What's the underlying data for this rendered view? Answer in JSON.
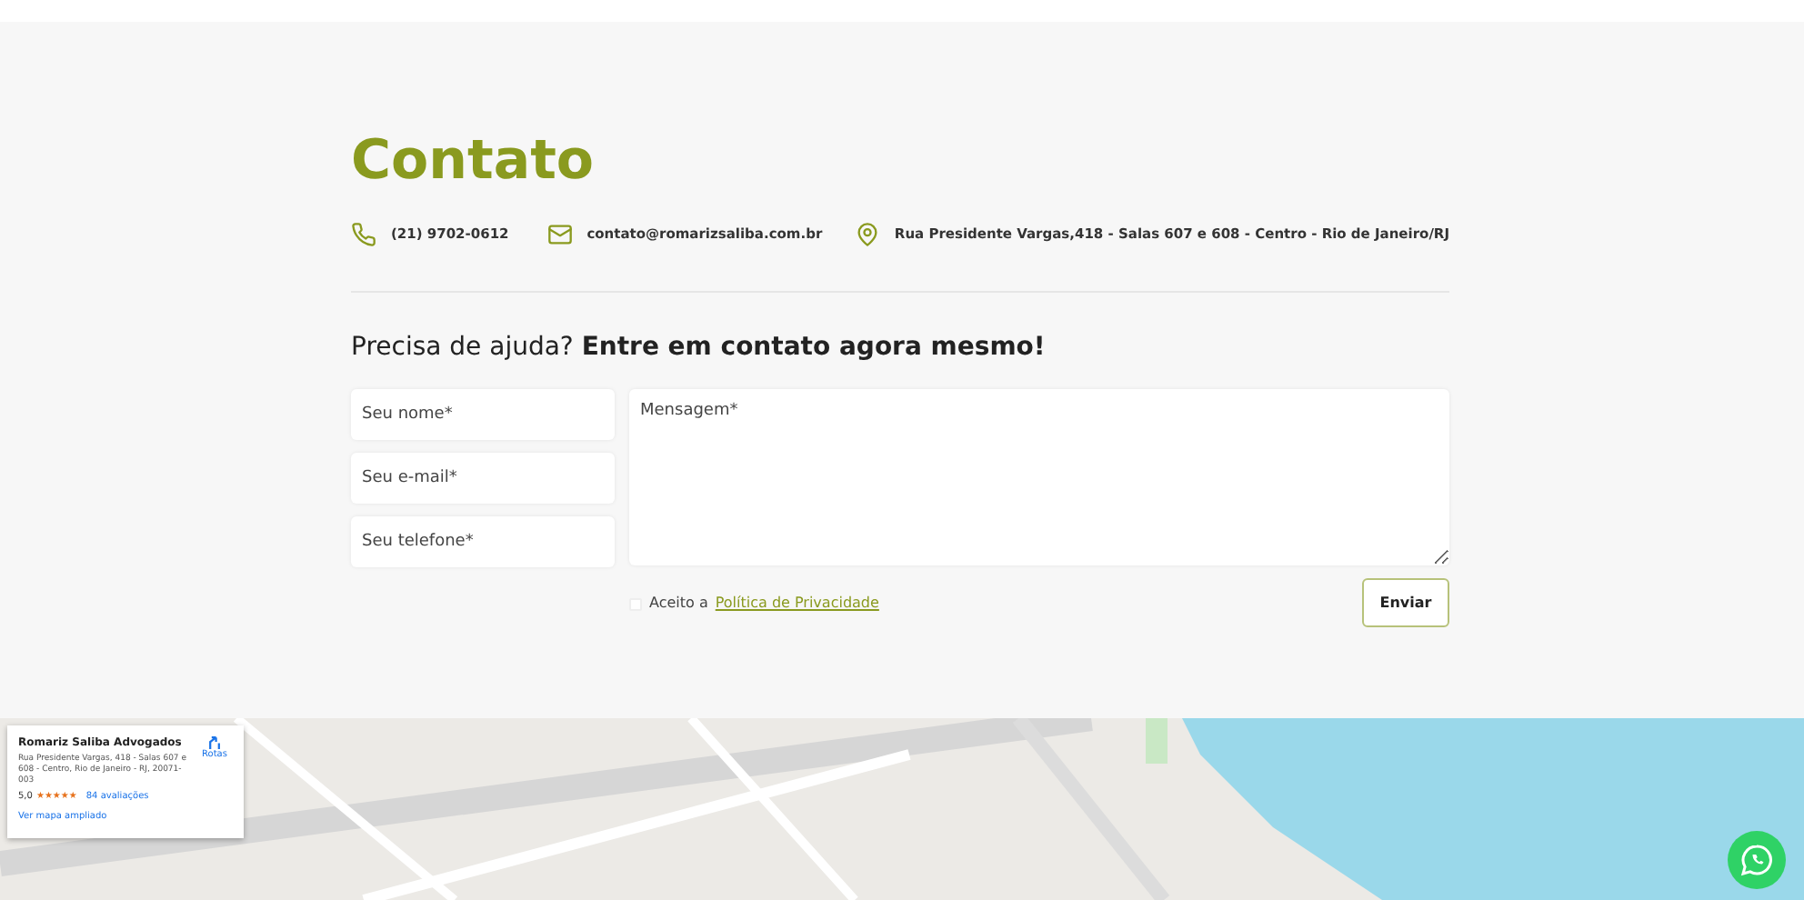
{
  "title": "Contato",
  "contacts": [
    {
      "kind": "phone",
      "text": "(21) 9702-0612"
    },
    {
      "kind": "email",
      "text": "contato@romarizsaliba.com.br"
    },
    {
      "kind": "location",
      "text": "Rua Presidente Vargas,418 - Salas 607 e 608 - Centro - Rio de Janeiro/RJ"
    }
  ],
  "heading": "Precisa de ajuda? **Entre em contato agora mesmo!**",
  "form": {
    "name": {
      "placeholder": "Seu nome*"
    },
    "email": {
      "placeholder": "Seu e-mail*"
    },
    "phone": {
      "placeholder": "Seu telefone*"
    },
    "message": {
      "placeholder": "Mensagem*"
    },
    "consent": {
      "checked": false,
      "label": "Aceito a",
      "link": "Política de Privacidade"
    },
    "submit": "Enviar"
  },
  "map_card": {
    "name": "Romariz Saliba Advogados",
    "address": "Rua Presidente Vargas, 418 - Salas 607 e 608 - Centro, Rio de Janeiro - RJ, 20071-003",
    "rating": "5,0",
    "stars": 5,
    "reviews": "84 avaliações",
    "directions": "Rotas",
    "link": "Ver mapa ampliado"
  }
}
